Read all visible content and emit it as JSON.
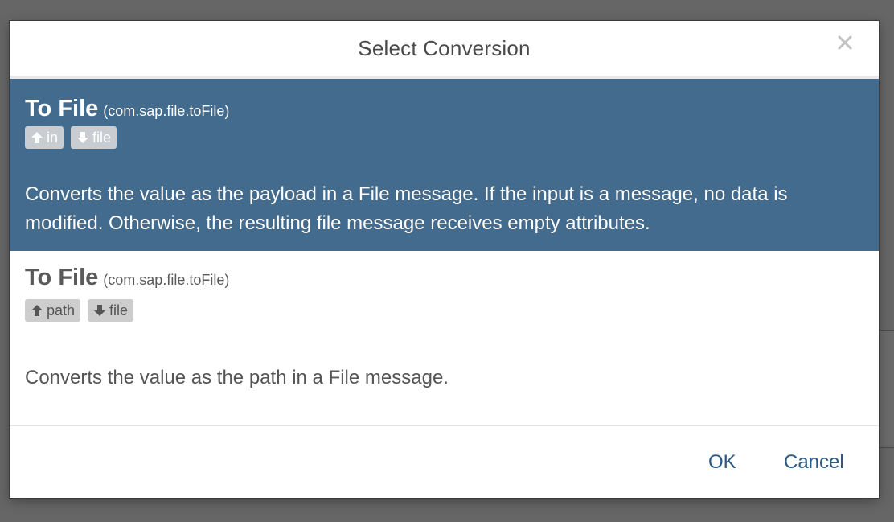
{
  "dialog": {
    "title": "Select Conversion",
    "close_icon": "close-icon"
  },
  "conversions": [
    {
      "name": "To File",
      "id": "(com.sap.file.toFile)",
      "input_badge": "in",
      "output_badge": "file",
      "description": "Converts the value as the payload in a File message. If the input is a message, no data is modified. Otherwise, the resulting file message receives empty attributes.",
      "selected": true
    },
    {
      "name": "To File",
      "id": "(com.sap.file.toFile)",
      "input_badge": "path",
      "output_badge": "file",
      "description": "Converts the value as the path in a File message.",
      "selected": false
    }
  ],
  "footer": {
    "ok_label": "OK",
    "cancel_label": "Cancel"
  },
  "colors": {
    "selection": "#426b8e",
    "accent_text": "#2b5a84",
    "overlay": "#666666"
  }
}
